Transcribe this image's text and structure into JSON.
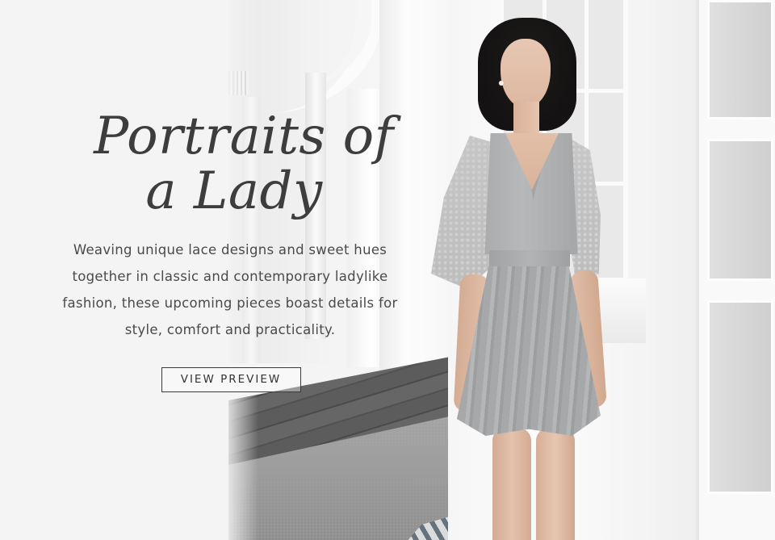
{
  "hero": {
    "headline_line1": "Portraits of",
    "headline_line2": "a Lady",
    "description": "Weaving unique lace designs and sweet hues together in classic and contemporary ladylike fashion, these upcoming pieces boast details for style, comfort and practicality.",
    "cta_label": "VIEW PREVIEW"
  },
  "colors": {
    "text": "#3d3d3d",
    "button_border": "#3a3a3a",
    "panel_bg": "#f4f4f4"
  }
}
